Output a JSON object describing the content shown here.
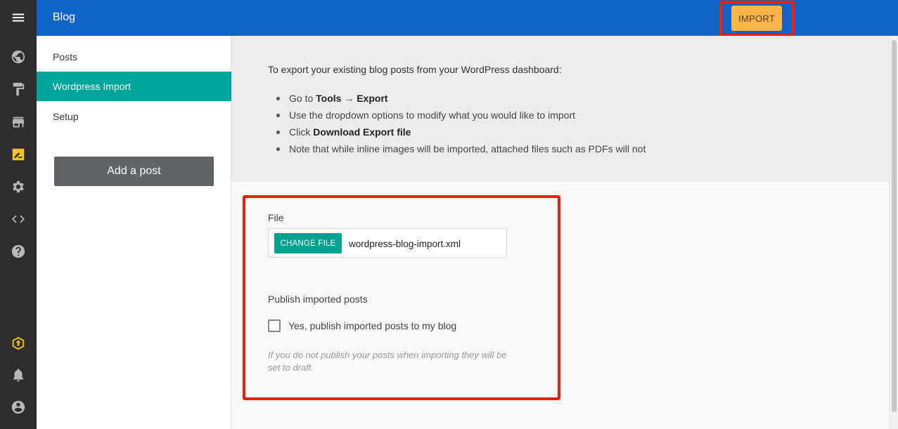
{
  "app": {
    "title": "Blog"
  },
  "header": {
    "import_label": "IMPORT"
  },
  "rail_icons": [
    "menu-icon",
    "globe-icon",
    "paint-roller-icon",
    "store-icon",
    "blog-icon",
    "gear-icon",
    "code-icon",
    "help-icon",
    "upgrade-icon",
    "bell-icon",
    "account-icon"
  ],
  "sidebar": {
    "items": [
      {
        "label": "Posts"
      },
      {
        "label": "Wordpress Import",
        "active": true
      },
      {
        "label": "Setup"
      }
    ],
    "add_post_label": "Add a post"
  },
  "instructions": {
    "lead": "To export your existing blog posts from your WordPress dashboard:",
    "step1_prefix": "Go to ",
    "step1_bold1": "Tools",
    "step1_arrow": " → ",
    "step1_bold2": "Export",
    "step2": "Use the dropdown options to modify what you would like to import",
    "step3_prefix": "Click ",
    "step3_bold": "Download Export file",
    "step4": "Note that while inline images will be imported, attached files such as PDFs will not"
  },
  "form": {
    "file_label": "File",
    "change_file_label": "CHANGE FILE",
    "file_name": "wordpress-blog-import.xml",
    "publish_label": "Publish imported posts",
    "publish_checkbox_label": "Yes, publish imported posts to my blog",
    "publish_checked": false,
    "hint": "If you do not publish your posts when importing they will be set to draft."
  },
  "colors": {
    "topbar": "#0f64c8",
    "accent": "#00a59a",
    "import_button": "#f9b54a",
    "highlight": "#f01c0c",
    "active_rail_icon": "#f5c518"
  }
}
